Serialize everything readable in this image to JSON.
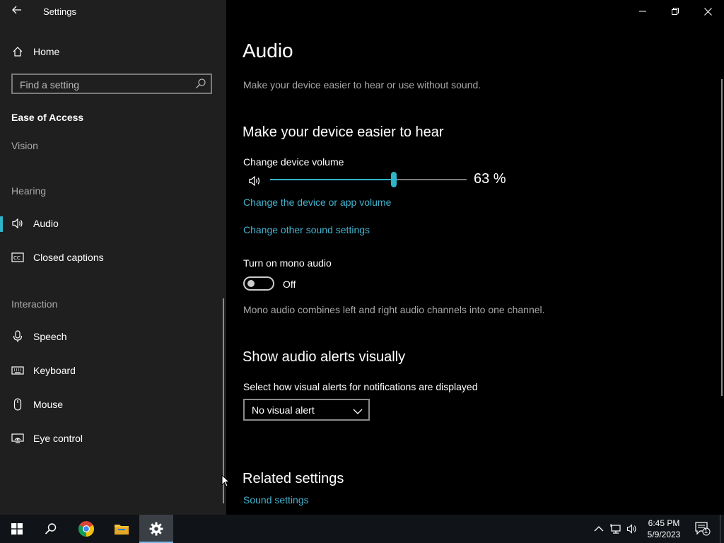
{
  "window": {
    "title": "Settings",
    "controls": {
      "minimize": "minimize",
      "restore": "restore",
      "close": "close"
    }
  },
  "sidebar": {
    "home_label": "Home",
    "search": {
      "placeholder": "Find a setting"
    },
    "category": "Ease of Access",
    "sections": [
      {
        "header": "Vision"
      },
      {
        "header": "Hearing",
        "items": [
          {
            "label": "Audio",
            "icon": "speaker-icon",
            "active": true
          },
          {
            "label": "Closed captions",
            "icon": "cc-icon"
          }
        ]
      },
      {
        "header": "Interaction",
        "items": [
          {
            "label": "Speech",
            "icon": "microphone-icon"
          },
          {
            "label": "Keyboard",
            "icon": "keyboard-icon"
          },
          {
            "label": "Mouse",
            "icon": "mouse-icon"
          },
          {
            "label": "Eye control",
            "icon": "eye-control-icon"
          }
        ]
      }
    ]
  },
  "main": {
    "title": "Audio",
    "subtitle": "Make your device easier to hear or use without sound.",
    "hear_section": {
      "heading": "Make your device easier to hear",
      "volume_label": "Change device volume",
      "volume_value": 63,
      "volume_text": "63 %",
      "link_app_volume": "Change the device or app volume",
      "link_other_sound": "Change other sound settings"
    },
    "mono": {
      "label": "Turn on mono audio",
      "state": "Off",
      "description": "Mono audio combines left and right audio channels into one channel."
    },
    "alerts": {
      "heading": "Show audio alerts visually",
      "select_label": "Select how visual alerts for notifications are displayed",
      "selected": "No visual alert"
    },
    "related": {
      "heading": "Related settings",
      "link_sound_settings": "Sound settings"
    }
  },
  "taskbar": {
    "clock_time": "6:45 PM",
    "clock_date": "5/9/2023",
    "notification_count": "1",
    "accent": "#76b9ed"
  },
  "colors": {
    "accent": "#2fb4c8",
    "link": "#43b3cf",
    "sidebar_bg": "#1f1f1f"
  }
}
